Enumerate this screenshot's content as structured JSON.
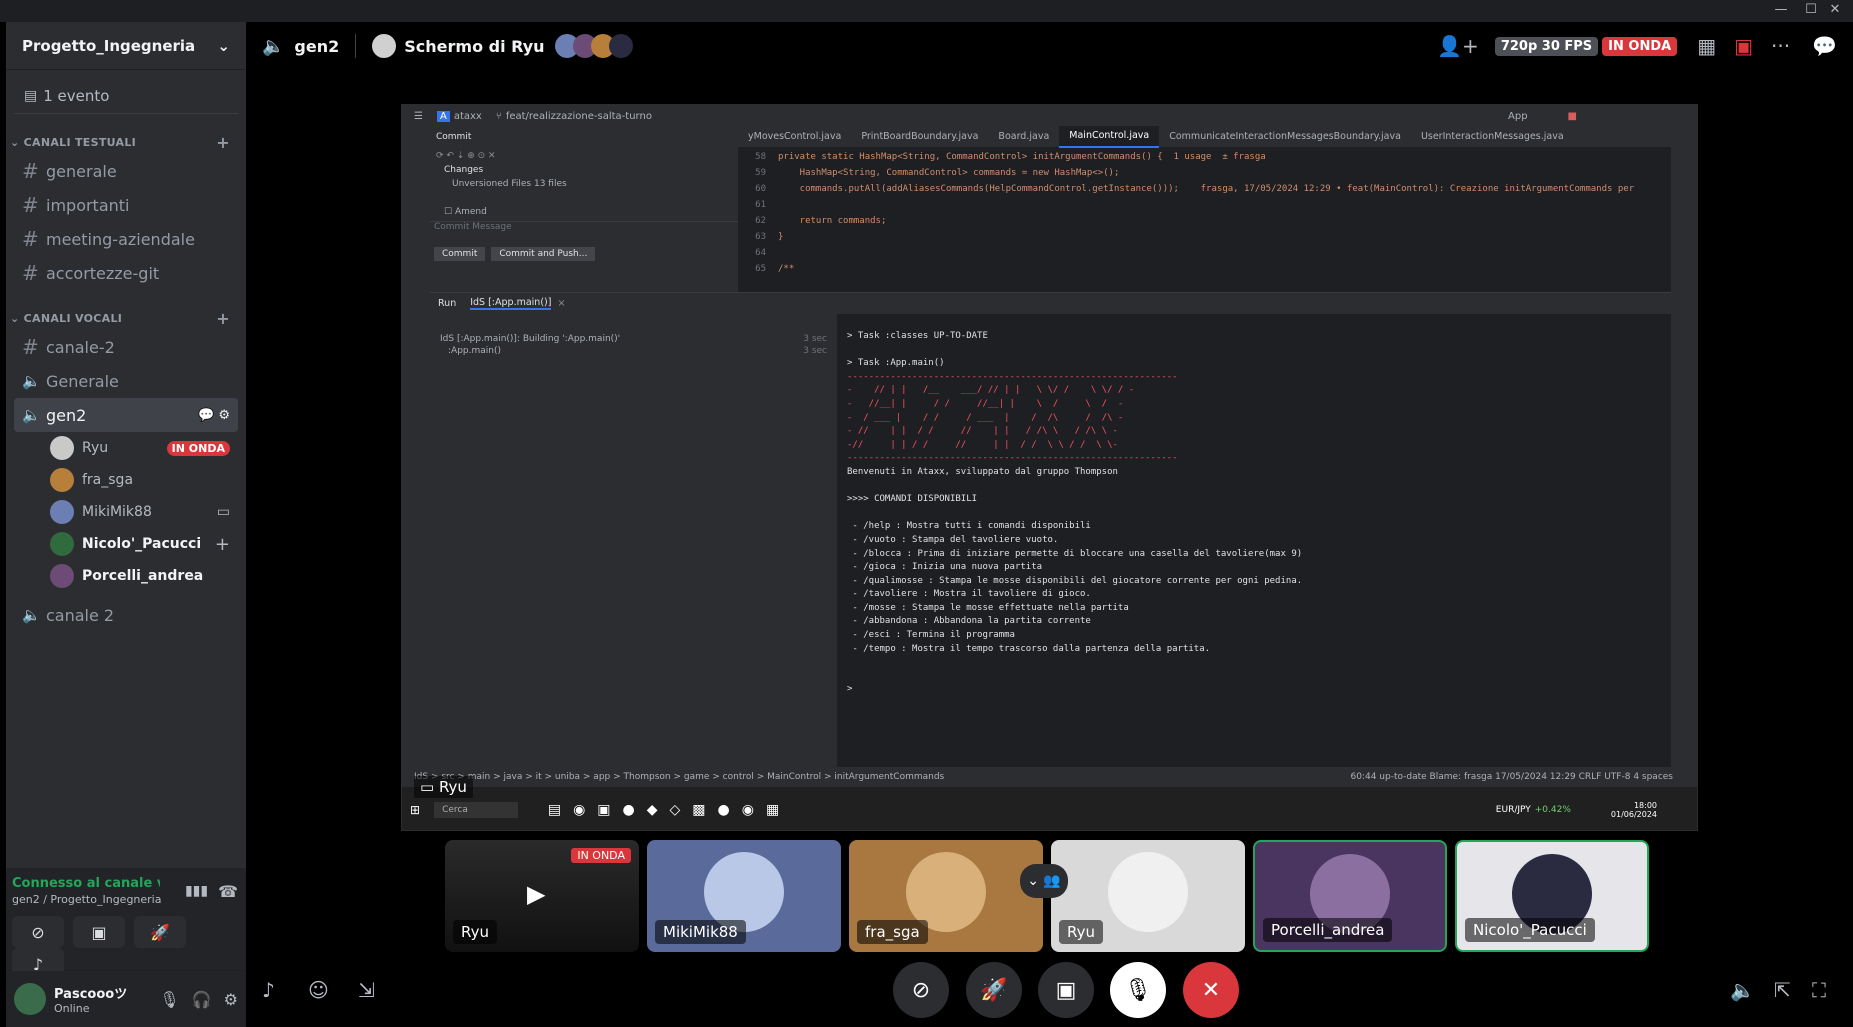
{
  "window": {
    "minimize": "—",
    "maximize": "☐",
    "close": "✕"
  },
  "server": {
    "name": "Progetto_Ingegneria",
    "chevron": "⌄"
  },
  "event": {
    "label": "1 evento",
    "icon": "calendar-icon"
  },
  "categories": {
    "text": "CANALI TESTUALI",
    "voice": "CANALI VOCALI",
    "add": "+"
  },
  "text_channels": [
    "generale",
    "importanti",
    "meeting-aziendale",
    "accortezze-git"
  ],
  "voice_channels": {
    "canale2_text": "canale-2",
    "generale": "Generale",
    "gen2": "gen2",
    "canale_2": "canale 2"
  },
  "voice_users": [
    {
      "name": "Ryu",
      "badge": "IN ONDA",
      "color": "#c9c9c9"
    },
    {
      "name": "fra_sga",
      "badge": "",
      "color": "#b87f3a"
    },
    {
      "name": "MikiMik88",
      "badge": "",
      "color": "#6b7fb5"
    },
    {
      "name": "Nicolo'_Pacucci",
      "badge": "",
      "color": "#2f6b3c",
      "bold": true
    },
    {
      "name": "Porcelli_andrea",
      "badge": "",
      "color": "#6d4b77",
      "bold": true
    }
  ],
  "voice_status": {
    "connected": "Connesso al canale vo",
    "location": "gen2 / Progetto_Ingegneria"
  },
  "user": {
    "name": "Pascoooツ",
    "status": "Online"
  },
  "topbar": {
    "channel": "gen2",
    "stream_title": "Schermo di Ryu",
    "quality": "720p 30 FPS",
    "live": "IN ONDA"
  },
  "ide": {
    "project": "ataxx",
    "branch": "feat/realizzazione-salta-turno",
    "app": "App",
    "tabs": [
      "yMovesControl.java",
      "PrintBoardBoundary.java",
      "Board.java",
      "MainControl.java",
      "CommunicateInteractionMessagesBoundary.java",
      "UserInteractionMessages.java"
    ],
    "commit_title": "Commit",
    "changes": "Changes",
    "unversioned": "Unversioned Files 13 files",
    "amend": "Amend",
    "commit_msg": "Commit Message",
    "btn_commit": "Commit",
    "btn_commit_push": "Commit and Push...",
    "code_lines": [
      {
        "n": "58",
        "t": "private static HashMap<String, CommandControl> initArgumentCommands() {  1 usage  ± frasga"
      },
      {
        "n": "59",
        "t": "    HashMap<String, CommandControl> commands = new HashMap<>();"
      },
      {
        "n": "60",
        "t": "    commands.putAll(addAliasesCommands(HelpCommandControl.getInstance()));    frasga, 17/05/2024 12:29 • feat(MainControl): Creazione initArgumentCommands per"
      },
      {
        "n": "61",
        "t": ""
      },
      {
        "n": "62",
        "t": "    return commands;"
      },
      {
        "n": "63",
        "t": "}"
      },
      {
        "n": "64",
        "t": ""
      },
      {
        "n": "65",
        "t": "/**"
      }
    ],
    "run_tab": "Run",
    "run_config": "IdS [:App.main()]",
    "run_tree": [
      "IdS [:App.main()]: Building ':App.main()'",
      "  :App.main()"
    ],
    "run_times": [
      "3 sec",
      "3 sec"
    ],
    "console_head": "> Task :classes UP-TO-DATE\n\n> Task :App.main()",
    "console_art": "-------------------------------------------------------------\n-    // | |   /__    ___/ // | |   \\ \\/ /    \\ \\/ / -\n-   //__| |     / /     //__| |    \\  /     \\  /  -\n-  / ___ |    / /     / ___  |    /  /\\     /  /\\ -\n- //    | |  / /     //    | |   / /\\ \\   / /\\ \\ -\n-//     | | / /     //     | |  / /  \\ \\ / /  \\ \\-\n-------------------------------------------------------------",
    "console_body": "Benvenuti in Ataxx, sviluppato dal gruppo Thompson\n\n>>>> COMANDI DISPONIBILI\n\n - /help : Mostra tutti i comandi disponibili\n - /vuoto : Stampa del tavoliere vuoto.\n - /blocca : Prima di iniziare permette di bloccare una casella del tavoliere(max 9)\n - /gioca : Inizia una nuova partita\n - /qualimosse : Stampa le mosse disponibili del giocatore corrente per ogni pedina.\n - /tavoliere : Mostra il tavoliere di gioco.\n - /mosse : Stampa le mosse effettuate nella partita\n - /abbandona : Abbandona la partita corrente\n - /esci : Termina il programma\n - /tempo : Mostra il tempo trascorso dalla partenza della partita.\n\n\n>",
    "breadcrumb": "IdS  >  src  >  main  >  java  >  it  >  uniba  >  app  >  Thompson  >  game  >  control  >  MainControl  >  initArgumentCommands",
    "status_right": "60:44    up-to-date    Blame: frasga 17/05/2024 12:29    CRLF    UTF-8    4 spaces",
    "taskbar_search": "Cerca",
    "currency": "EUR/JPY",
    "currency_change": "+0.42%",
    "time": "18:00",
    "date": "01/06/2024"
  },
  "stream_owner": "Ryu",
  "tiles": [
    {
      "name": "Ryu",
      "bg": "#1a1a1a",
      "badge": "IN ONDA",
      "preview": true
    },
    {
      "name": "MikiMik88",
      "bg": "#5a6a9a",
      "av": "#b9c8e6"
    },
    {
      "name": "fra_sga",
      "bg": "#a87840",
      "av": "#d9b07a"
    },
    {
      "name": "Ryu",
      "bg": "#d9d9d9",
      "av": "#f0f0f0"
    },
    {
      "name": "Porcelli_andrea",
      "bg": "#4a3560",
      "av": "#8a6fa0",
      "speaking": true
    },
    {
      "name": "Nicolo'_Pacucci",
      "bg": "#e6e6ea",
      "av": "#2a2a40",
      "speaking": true
    }
  ]
}
